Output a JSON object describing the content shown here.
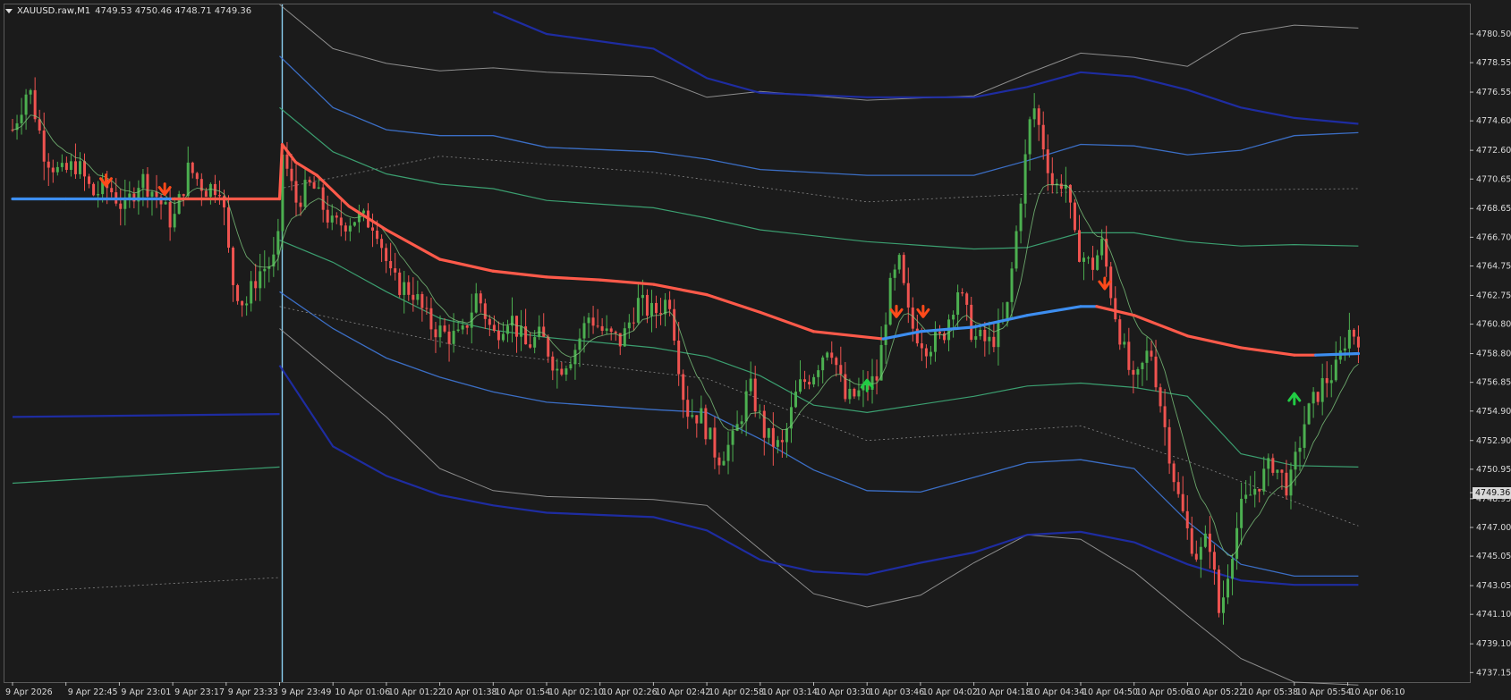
{
  "header": {
    "symbol": "XAUUSD.raw,M1",
    "ohlc": "4749.53 4750.46 4748.71 4749.36"
  },
  "price_axis": {
    "labels": [
      "4780.50",
      "4778.55",
      "4776.55",
      "4774.60",
      "4772.60",
      "4770.65",
      "4768.65",
      "4766.70",
      "4764.75",
      "4762.75",
      "4760.80",
      "4758.80",
      "4756.85",
      "4754.90",
      "4752.90",
      "4750.95",
      "4748.95",
      "4747.00",
      "4745.05",
      "4743.05",
      "4741.10",
      "4739.10",
      "4737.15"
    ],
    "current_price": "4749.36"
  },
  "time_axis": {
    "labels": [
      "9 Apr 2026",
      "9 Apr 22:45",
      "9 Apr 23:01",
      "9 Apr 23:17",
      "9 Apr 23:33",
      "9 Apr 23:49",
      "10 Apr 01:06",
      "10 Apr 01:22",
      "10 Apr 01:38",
      "10 Apr 01:54",
      "10 Apr 02:10",
      "10 Apr 02:26",
      "10 Apr 02:42",
      "10 Apr 02:58",
      "10 Apr 03:14",
      "10 Apr 03:30",
      "10 Apr 03:46",
      "10 Apr 04:02",
      "10 Apr 04:18",
      "10 Apr 04:34",
      "10 Apr 04:50",
      "10 Apr 05:06",
      "10 Apr 05:22",
      "10 Apr 05:38",
      "10 Apr 05:54",
      "10 Apr 06:10"
    ]
  },
  "colors": {
    "background": "#1b1b1b",
    "grid": "#6a6a6a",
    "bull_candle": "#4caf50",
    "bear_candle": "#ef5350",
    "trend_up": "#3d8ef0",
    "trend_down": "#ff5a4a",
    "band_blue": "#1f2fb0",
    "band_light_blue": "#3f78d8",
    "band_green": "#3fae7a",
    "band_gray": "#9a9a9a",
    "arrow_sell": "#ff4a1a",
    "arrow_buy": "#22cc44"
  },
  "chart_data": {
    "type": "candlestick",
    "symbol": "XAUUSD.raw",
    "timeframe": "M1",
    "ylim": [
      4736.5,
      4782.5
    ],
    "last_price": 4749.36,
    "trend_line": [
      {
        "t": 0,
        "v": 4769.3,
        "dir": "up"
      },
      {
        "t": 1,
        "v": 4769.3,
        "dir": "up"
      },
      {
        "t": 2,
        "v": 4769.3,
        "dir": "up"
      },
      {
        "t": 3,
        "v": 4769.3,
        "dir": "up"
      },
      {
        "t": 4,
        "v": 4769.3,
        "dir": "down"
      },
      {
        "t": 5,
        "v": 4769.3,
        "dir": "down"
      },
      {
        "t": 5.05,
        "v": 4773.0,
        "dir": "down"
      },
      {
        "t": 5.3,
        "v": 4771.8,
        "dir": "down"
      },
      {
        "t": 5.7,
        "v": 4770.9,
        "dir": "down"
      },
      {
        "t": 6.3,
        "v": 4768.8,
        "dir": "down"
      },
      {
        "t": 7,
        "v": 4767.2,
        "dir": "down"
      },
      {
        "t": 8,
        "v": 4765.2,
        "dir": "down"
      },
      {
        "t": 9,
        "v": 4764.4,
        "dir": "down"
      },
      {
        "t": 10,
        "v": 4764.0,
        "dir": "down"
      },
      {
        "t": 11,
        "v": 4763.8,
        "dir": "down"
      },
      {
        "t": 12,
        "v": 4763.5,
        "dir": "down"
      },
      {
        "t": 13,
        "v": 4762.8,
        "dir": "down"
      },
      {
        "t": 14,
        "v": 4761.6,
        "dir": "down"
      },
      {
        "t": 15,
        "v": 4760.3,
        "dir": "down"
      },
      {
        "t": 16.3,
        "v": 4759.8,
        "dir": "down"
      },
      {
        "t": 16.3,
        "v": 4759.8,
        "dir": "up"
      },
      {
        "t": 17,
        "v": 4760.3,
        "dir": "up"
      },
      {
        "t": 18,
        "v": 4760.6,
        "dir": "up"
      },
      {
        "t": 19,
        "v": 4761.4,
        "dir": "up"
      },
      {
        "t": 20,
        "v": 4762.0,
        "dir": "up"
      },
      {
        "t": 20.3,
        "v": 4762.0,
        "dir": "up"
      },
      {
        "t": 20.3,
        "v": 4762.0,
        "dir": "down"
      },
      {
        "t": 21,
        "v": 4761.4,
        "dir": "down"
      },
      {
        "t": 22,
        "v": 4760.0,
        "dir": "down"
      },
      {
        "t": 23,
        "v": 4759.2,
        "dir": "down"
      },
      {
        "t": 24,
        "v": 4758.7,
        "dir": "down"
      },
      {
        "t": 24.4,
        "v": 4758.7,
        "dir": "down"
      },
      {
        "t": 24.4,
        "v": 4758.7,
        "dir": "up"
      },
      {
        "t": 25.2,
        "v": 4758.8,
        "dir": "up"
      }
    ],
    "bands": [
      {
        "name": "upper-outer-gray",
        "color": "gray",
        "points": [
          [
            5,
            4782.5
          ],
          [
            6,
            4779.5
          ],
          [
            7,
            4778.5
          ],
          [
            8,
            4778.0
          ],
          [
            9,
            4778.2
          ],
          [
            10,
            4777.9
          ],
          [
            12,
            4777.6
          ],
          [
            13,
            4776.2
          ],
          [
            14,
            4776.6
          ],
          [
            16,
            4776.0
          ],
          [
            18,
            4776.3
          ],
          [
            19,
            4777.8
          ],
          [
            20,
            4779.2
          ],
          [
            21,
            4778.9
          ],
          [
            22,
            4778.3
          ],
          [
            23,
            4780.5
          ],
          [
            24,
            4781.1
          ],
          [
            25.2,
            4780.9
          ]
        ]
      },
      {
        "name": "upper-blue-thick",
        "color": "blue",
        "points": [
          [
            9,
            4782.0
          ],
          [
            10,
            4780.5
          ],
          [
            12,
            4779.5
          ],
          [
            13,
            4777.5
          ],
          [
            14,
            4776.5
          ],
          [
            16,
            4776.2
          ],
          [
            18,
            4776.2
          ],
          [
            19,
            4776.9
          ],
          [
            20,
            4777.9
          ],
          [
            21,
            4777.6
          ],
          [
            22,
            4776.7
          ],
          [
            23,
            4775.5
          ],
          [
            24,
            4774.8
          ],
          [
            25.2,
            4774.4
          ]
        ]
      },
      {
        "name": "upper-light-blue",
        "color": "lightblue",
        "points": [
          [
            5,
            4779.0
          ],
          [
            6,
            4775.5
          ],
          [
            7,
            4774.0
          ],
          [
            8,
            4773.6
          ],
          [
            9,
            4773.6
          ],
          [
            10,
            4772.8
          ],
          [
            12,
            4772.5
          ],
          [
            13,
            4772.0
          ],
          [
            14,
            4771.3
          ],
          [
            16,
            4770.9
          ],
          [
            18,
            4770.9
          ],
          [
            19,
            4771.9
          ],
          [
            20,
            4773.0
          ],
          [
            21,
            4772.9
          ],
          [
            22,
            4772.3
          ],
          [
            23,
            4772.6
          ],
          [
            24,
            4773.6
          ],
          [
            25.2,
            4773.8
          ]
        ]
      },
      {
        "name": "upper-green",
        "color": "green",
        "points": [
          [
            5,
            4775.5
          ],
          [
            6,
            4772.5
          ],
          [
            7,
            4771.0
          ],
          [
            8,
            4770.3
          ],
          [
            9,
            4770.0
          ],
          [
            10,
            4769.2
          ],
          [
            12,
            4768.7
          ],
          [
            13,
            4768.0
          ],
          [
            14,
            4767.2
          ],
          [
            16,
            4766.4
          ],
          [
            18,
            4765.9
          ],
          [
            19,
            4766.0
          ],
          [
            20,
            4767.0
          ],
          [
            21,
            4767.0
          ],
          [
            22,
            4766.4
          ],
          [
            23,
            4766.1
          ],
          [
            24,
            4766.2
          ],
          [
            25.2,
            4766.1
          ]
        ]
      },
      {
        "name": "lower-green",
        "color": "green",
        "points": [
          [
            5,
            4766.5
          ],
          [
            6,
            4765.0
          ],
          [
            7,
            4763.0
          ],
          [
            8,
            4761.2
          ],
          [
            9,
            4760.4
          ],
          [
            10,
            4759.9
          ],
          [
            12,
            4759.2
          ],
          [
            13,
            4758.6
          ],
          [
            14,
            4757.3
          ],
          [
            15,
            4755.3
          ],
          [
            16,
            4754.8
          ],
          [
            18,
            4755.9
          ],
          [
            19,
            4756.6
          ],
          [
            20,
            4756.8
          ],
          [
            21,
            4756.5
          ],
          [
            22,
            4755.9
          ],
          [
            23,
            4752.0
          ],
          [
            24,
            4751.2
          ],
          [
            25.2,
            4751.1
          ]
        ]
      },
      {
        "name": "lower-light-blue",
        "color": "lightblue",
        "points": [
          [
            5,
            4763.0
          ],
          [
            6,
            4760.5
          ],
          [
            7,
            4758.5
          ],
          [
            8,
            4757.2
          ],
          [
            9,
            4756.2
          ],
          [
            10,
            4755.5
          ],
          [
            12,
            4755.0
          ],
          [
            13,
            4754.8
          ],
          [
            14,
            4753.0
          ],
          [
            15,
            4750.9
          ],
          [
            16,
            4749.5
          ],
          [
            17,
            4749.4
          ],
          [
            18,
            4750.4
          ],
          [
            19,
            4751.4
          ],
          [
            20,
            4751.6
          ],
          [
            21,
            4751.0
          ],
          [
            22,
            4747.4
          ],
          [
            23,
            4744.5
          ],
          [
            24,
            4743.7
          ],
          [
            25.2,
            4743.7
          ]
        ]
      },
      {
        "name": "lower-gray",
        "color": "gray",
        "points": [
          [
            5,
            4760.5
          ],
          [
            6,
            4757.5
          ],
          [
            7,
            4754.5
          ],
          [
            8,
            4751.0
          ],
          [
            9,
            4749.5
          ],
          [
            10,
            4749.1
          ],
          [
            12,
            4748.9
          ],
          [
            13,
            4748.5
          ],
          [
            14,
            4745.5
          ],
          [
            15,
            4742.5
          ],
          [
            16,
            4741.6
          ],
          [
            17,
            4742.4
          ],
          [
            18,
            4744.6
          ],
          [
            19,
            4746.5
          ],
          [
            20,
            4746.2
          ],
          [
            21,
            4744.0
          ],
          [
            22,
            4741.0
          ],
          [
            23,
            4738.1
          ],
          [
            24,
            4736.5
          ],
          [
            25.2,
            4736.3
          ]
        ]
      },
      {
        "name": "lower-blue-thick",
        "color": "blue",
        "points": [
          [
            5,
            4758.0
          ],
          [
            6,
            4752.5
          ],
          [
            7,
            4750.5
          ],
          [
            8,
            4749.2
          ],
          [
            9,
            4748.5
          ],
          [
            10,
            4748.0
          ],
          [
            12,
            4747.7
          ],
          [
            13,
            4746.8
          ],
          [
            14,
            4744.8
          ],
          [
            15,
            4744.0
          ],
          [
            16,
            4743.8
          ],
          [
            17,
            4744.6
          ],
          [
            18,
            4745.3
          ],
          [
            19,
            4746.5
          ],
          [
            20,
            4746.7
          ],
          [
            21,
            4746.0
          ],
          [
            22,
            4744.5
          ],
          [
            23,
            4743.4
          ],
          [
            24,
            4743.1
          ],
          [
            25.2,
            4743.1
          ]
        ]
      },
      {
        "name": "left-blue",
        "color": "blue",
        "points": [
          [
            0,
            4754.5
          ],
          [
            5,
            4754.7
          ]
        ]
      },
      {
        "name": "left-green",
        "color": "green",
        "points": [
          [
            0,
            4750.0
          ],
          [
            5,
            4751.1
          ]
        ]
      }
    ],
    "signals": [
      {
        "type": "sell",
        "t": 1.75,
        "v": 4770.2
      },
      {
        "type": "sell",
        "t": 2.85,
        "v": 4769.6
      },
      {
        "type": "buy",
        "t": 16.0,
        "v": 4757.0
      },
      {
        "type": "sell",
        "t": 16.55,
        "v": 4761.3
      },
      {
        "type": "sell",
        "t": 17.05,
        "v": 4761.3
      },
      {
        "type": "sell",
        "t": 20.45,
        "v": 4763.2
      },
      {
        "type": "buy",
        "t": 24.0,
        "v": 4756.1
      }
    ],
    "price_path": [
      [
        0,
        4774
      ],
      [
        0.3,
        4777
      ],
      [
        0.6,
        4772.4
      ],
      [
        0.9,
        4770.9
      ],
      [
        1.2,
        4771.7
      ],
      [
        1.5,
        4769.6
      ],
      [
        1.8,
        4770.1
      ],
      [
        2.1,
        4768.6
      ],
      [
        2.4,
        4770.8
      ],
      [
        2.7,
        4769.5
      ],
      [
        3.0,
        4767.6
      ],
      [
        3.3,
        4771.4
      ],
      [
        3.6,
        4770.0
      ],
      [
        3.9,
        4770.3
      ],
      [
        4.1,
        4763.9
      ],
      [
        4.35,
        4762.0
      ],
      [
        4.6,
        4764.3
      ],
      [
        4.9,
        4765.1
      ],
      [
        5.0,
        4766.8
      ],
      [
        5.05,
        4772.5
      ],
      [
        5.3,
        4769.1
      ],
      [
        5.6,
        4770.3
      ],
      [
        6.0,
        4767.4
      ],
      [
        6.4,
        4768.0
      ],
      [
        6.8,
        4767.7
      ],
      [
        7.1,
        4763.7
      ],
      [
        7.5,
        4763.0
      ],
      [
        7.8,
        4760.8
      ],
      [
        8.1,
        4760.1
      ],
      [
        8.4,
        4759.8
      ],
      [
        8.7,
        4762.9
      ],
      [
        9.0,
        4760.0
      ],
      [
        9.3,
        4761.5
      ],
      [
        9.6,
        4759.3
      ],
      [
        9.9,
        4760.0
      ],
      [
        10.2,
        4757.7
      ],
      [
        10.5,
        4758.9
      ],
      [
        10.8,
        4761.4
      ],
      [
        11.1,
        4760.1
      ],
      [
        11.4,
        4759.6
      ],
      [
        11.7,
        4762.3
      ],
      [
        12.0,
        4761.5
      ],
      [
        12.3,
        4762.6
      ],
      [
        12.6,
        4755.0
      ],
      [
        12.9,
        4754.5
      ],
      [
        13.2,
        4751.7
      ],
      [
        13.5,
        4752.9
      ],
      [
        13.8,
        4756.6
      ],
      [
        14.1,
        4753.2
      ],
      [
        14.4,
        4752.3
      ],
      [
        14.7,
        4756.4
      ],
      [
        15.0,
        4757.6
      ],
      [
        15.3,
        4759.7
      ],
      [
        15.6,
        4755.6
      ],
      [
        15.9,
        4756.2
      ],
      [
        16.2,
        4757.2
      ],
      [
        16.4,
        4762.8
      ],
      [
        16.6,
        4764.9
      ],
      [
        16.8,
        4760.8
      ],
      [
        17.1,
        4759.4
      ],
      [
        17.4,
        4759.8
      ],
      [
        17.7,
        4763.2
      ],
      [
        18.0,
        4759.9
      ],
      [
        18.3,
        4759.5
      ],
      [
        18.6,
        4761.1
      ],
      [
        18.9,
        4770.2
      ],
      [
        19.1,
        4775.9
      ],
      [
        19.3,
        4773.0
      ],
      [
        19.5,
        4769.9
      ],
      [
        19.7,
        4770.8
      ],
      [
        19.9,
        4766.2
      ],
      [
        20.2,
        4764.6
      ],
      [
        20.4,
        4766.2
      ],
      [
        20.6,
        4762.3
      ],
      [
        20.8,
        4759.1
      ],
      [
        21.0,
        4756.4
      ],
      [
        21.3,
        4759.3
      ],
      [
        21.6,
        4753.3
      ],
      [
        21.8,
        4749.4
      ],
      [
        22.0,
        4746.7
      ],
      [
        22.2,
        4744.9
      ],
      [
        22.4,
        4746.5
      ],
      [
        22.6,
        4740.9
      ],
      [
        22.8,
        4745.0
      ],
      [
        23.0,
        4748.2
      ],
      [
        23.3,
        4749.9
      ],
      [
        23.6,
        4751.4
      ],
      [
        23.9,
        4749.6
      ],
      [
        24.2,
        4754.3
      ],
      [
        24.5,
        4756.6
      ],
      [
        24.8,
        4757.8
      ],
      [
        25.0,
        4760.4
      ],
      [
        25.2,
        4760.0
      ]
    ]
  }
}
